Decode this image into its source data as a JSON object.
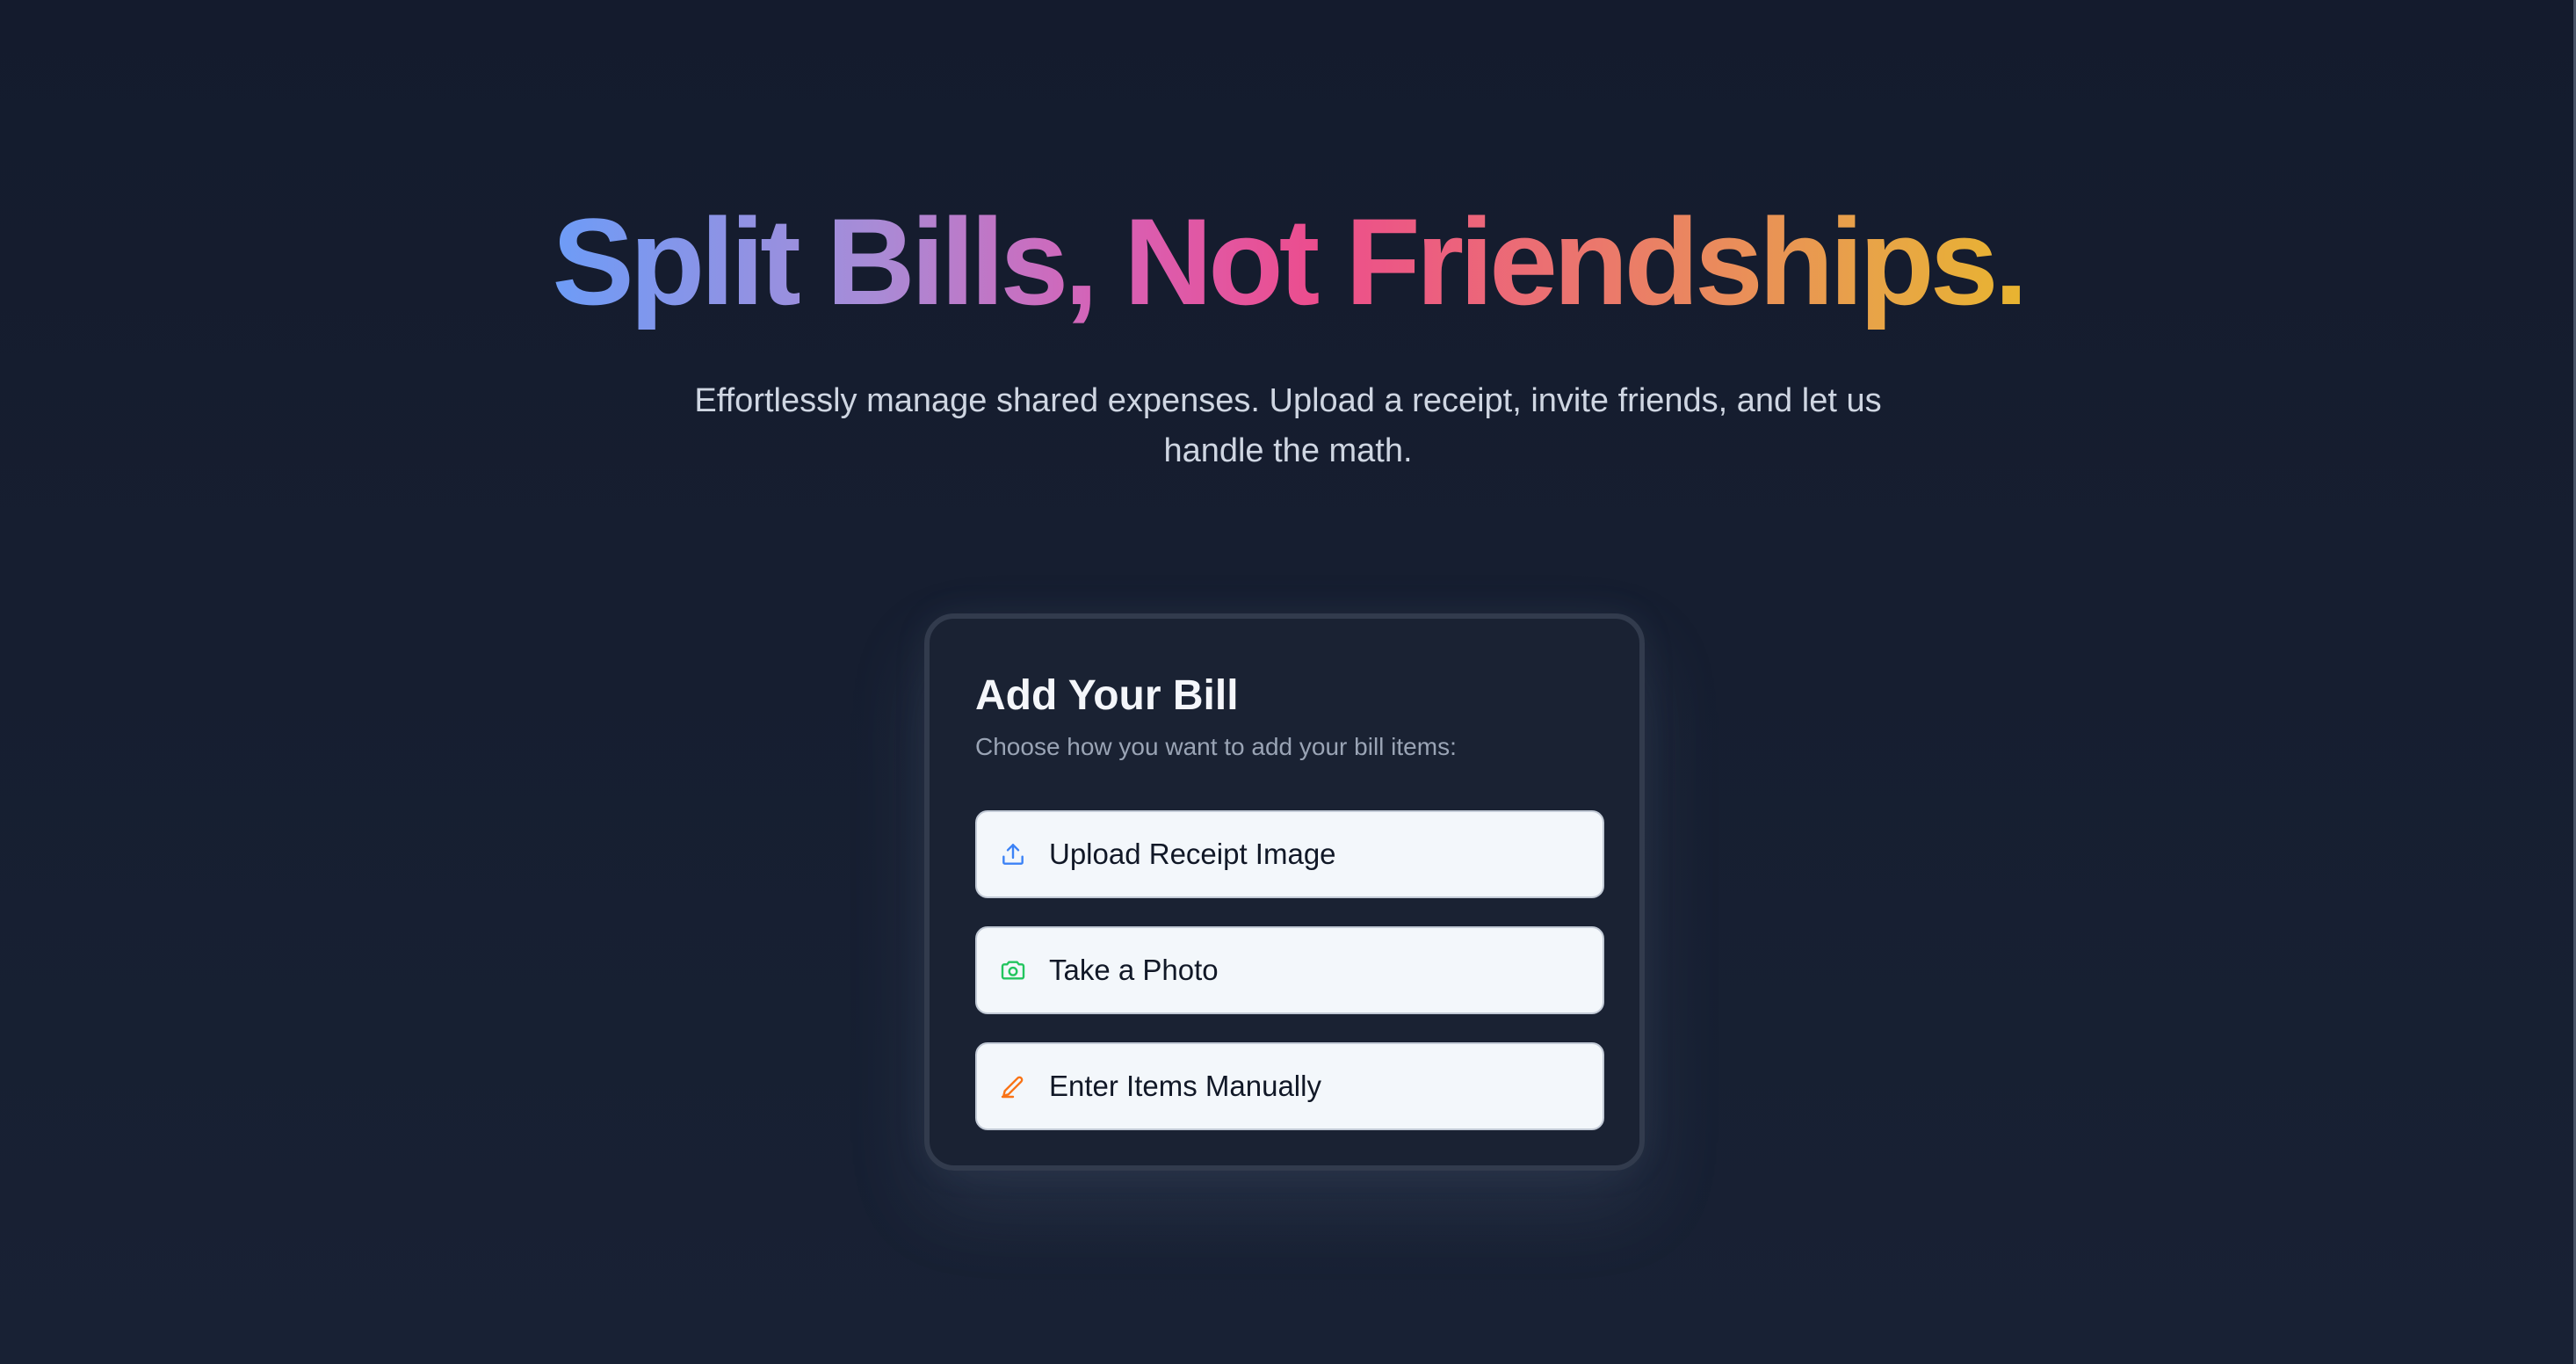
{
  "hero": {
    "title": "Split Bills, Not Friendships.",
    "subtitle": "Effortlessly manage shared expenses. Upload a receipt, invite friends, and let us handle the math."
  },
  "card": {
    "title": "Add Your Bill",
    "subtitle": "Choose how you want to add your bill items:",
    "options": [
      {
        "label": "Upload Receipt Image",
        "icon": "upload-icon",
        "icon_color": "#3b82f6"
      },
      {
        "label": "Take a Photo",
        "icon": "camera-icon",
        "icon_color": "#22c55e"
      },
      {
        "label": "Enter Items Manually",
        "icon": "pencil-icon",
        "icon_color": "#f97316"
      }
    ]
  },
  "colors": {
    "background": "#141b2d",
    "card_background": "#1a2233",
    "card_border": "#323b4d",
    "option_background": "#f3f7fb",
    "title_gradient": [
      "#6d9cf7",
      "#d860b5",
      "#ec4d8d",
      "#e8b430"
    ]
  }
}
